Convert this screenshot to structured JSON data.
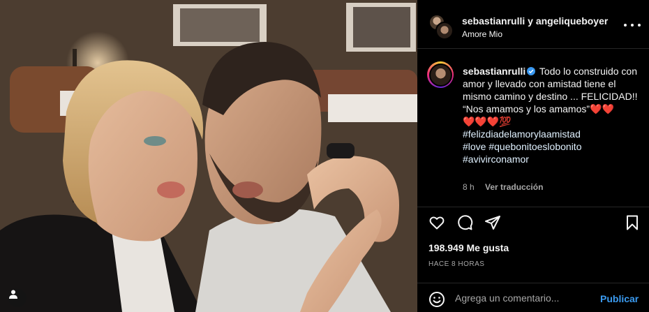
{
  "post": {
    "photo": {
      "icon": "user-tag-icon"
    },
    "header": {
      "user1": "sebastianrulli",
      "conjunction": "y",
      "user2": "angeliqueboyer",
      "song": "Amore Mio",
      "more_icon": "more-horizontal-icon"
    },
    "caption": {
      "username": "sebastianrulli",
      "verified_icon": "verified-badge-icon",
      "line1": "Todo lo construido con amor y llevado con amistad tiene el mismo camino y destino ... FELICIDAD!!",
      "line2": "“Nos amamos y los amamos”❤️❤️",
      "line3": "❤️❤️❤️💯",
      "hashtags": [
        "#felizdiadelamorylaamistad",
        "#love #quebonitoeslobonito",
        "#avivirconamor"
      ],
      "time": "8 h",
      "translate_label": "Ver traducción"
    },
    "actions": {
      "like_icon": "heart-icon",
      "comment_icon": "comment-icon",
      "share_icon": "share-icon",
      "save_icon": "bookmark-icon"
    },
    "likes": "198.949 Me gusta",
    "time_ago": "HACE 8 HORAS",
    "comment": {
      "emoji_icon": "emoji-icon",
      "placeholder": "Agrega un comentario...",
      "publish_label": "Publicar"
    },
    "colors": {
      "background": "#000000",
      "link": "#3b9bf0",
      "secondary_text": "#a8a8a8",
      "verified": "#3897f0"
    }
  }
}
